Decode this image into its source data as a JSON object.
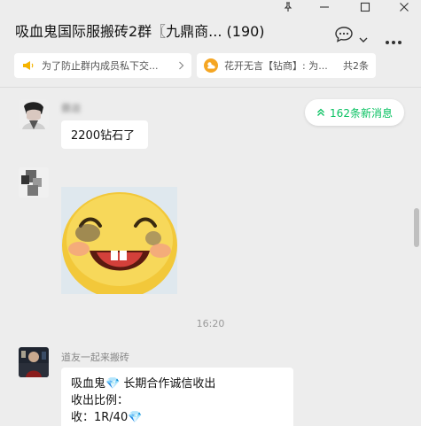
{
  "window": {
    "pin_icon": "pin-icon",
    "minimize_icon": "minimize-icon",
    "maximize_icon": "maximize-icon",
    "close_icon": "close-icon"
  },
  "header": {
    "title": "吸血鬼国际服搬砖2群〖九鼎商... (190)",
    "chat_icon": "chat-bubble-icon",
    "dropdown_icon": "chevron-down-icon",
    "more_icon": "more-icon"
  },
  "pinned": {
    "left": {
      "text": "为了防止群内成员私下交...",
      "icon": "megaphone-icon",
      "color": "#f5b400"
    },
    "right": {
      "text": "花开无言【钻商】: 为...",
      "count": "共2条",
      "icon": "weather-icon",
      "color": "#f5a623"
    }
  },
  "new_messages": {
    "label": "162条新消息",
    "icon": "double-chevron-up-icon",
    "color": "#07c160"
  },
  "messages": [
    {
      "sender": "爨迦",
      "text": "2200钻石了"
    },
    {
      "sender": "",
      "sticker": "laughing-emoji-sticker"
    },
    {
      "time": "16:20"
    },
    {
      "sender": "道友一起来搬砖",
      "lines": [
        "吸血鬼💎 长期合作诚信收出",
        "收出比例：",
        "收：1R/40💎"
      ]
    }
  ]
}
